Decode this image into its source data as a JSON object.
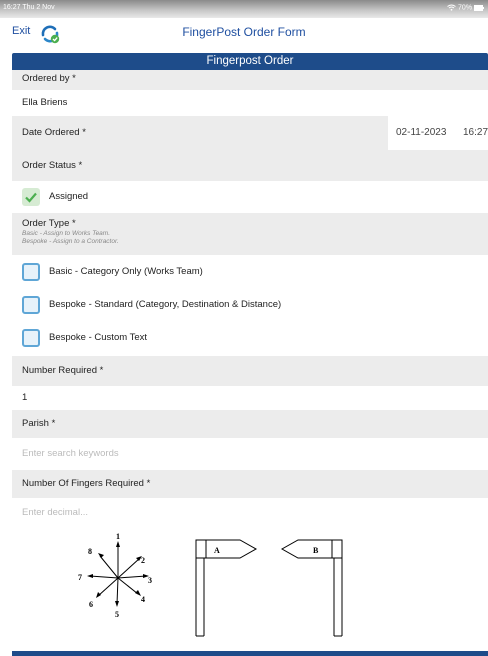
{
  "status_bar": {
    "time": "16:27  Thu 2 Nov",
    "battery": "70%"
  },
  "nav": {
    "exit_label": "Exit",
    "title": "FingerPost Order Form"
  },
  "section": {
    "title": "Fingerpost Order"
  },
  "ordered_by": {
    "label": "Ordered by *",
    "value": "Ella Briens"
  },
  "date_ordered": {
    "label": "Date Ordered *",
    "date": "02-11-2023",
    "time": "16:27"
  },
  "order_status": {
    "label": "Order Status *",
    "option": "Assigned"
  },
  "order_type": {
    "label": "Order Type *",
    "hint1": "Basic - Assign to Works Team.",
    "hint2": "Bespoke - Assign to a Contractor.",
    "options": [
      "Basic - Category Only (Works Team)",
      "Bespoke - Standard (Category, Destination & Distance)",
      "Bespoke - Custom Text"
    ]
  },
  "number_required": {
    "label": "Number Required *",
    "value": "1"
  },
  "parish": {
    "label": "Parish *",
    "placeholder": "Enter search keywords"
  },
  "fingers": {
    "label": "Number Of Fingers Required *",
    "placeholder": "Enter decimal..."
  },
  "diagram": {
    "compass_numbers": [
      "1",
      "2",
      "3",
      "4",
      "5",
      "6",
      "7",
      "8"
    ],
    "sign_a": "A",
    "sign_b": "B"
  },
  "colors": {
    "accent": "#1e4c8a",
    "link": "#1f4fa0",
    "check": "#4caf50",
    "checkbox_border": "#5fa6d6"
  }
}
